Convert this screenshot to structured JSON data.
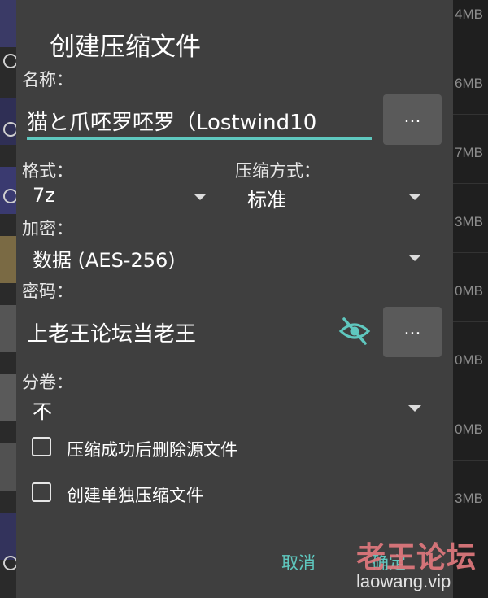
{
  "background": {
    "sizes": [
      "4MB",
      "6MB",
      "7MB",
      "3MB",
      "0MB",
      "0MB",
      "0MB",
      "3MB"
    ]
  },
  "dialog": {
    "title": "创建压缩文件",
    "name_label": "名称：",
    "name_value": "猫と爪呸罗呸罗（Lostwind10",
    "browse_label": "...",
    "format_label": "格式：",
    "format_value": "7z",
    "method_label": "压缩方式：",
    "method_value": "标准",
    "encryption_label": "加密：",
    "encryption_value": "数据 (AES-256)",
    "password_label": "密码：",
    "password_value": "上老王论坛当老王",
    "password_browse_label": "...",
    "split_label": "分卷：",
    "split_value": "不",
    "delete_source_label": "压缩成功后删除源文件",
    "separate_archive_label": "创建单独压缩文件",
    "cancel_label": "取消",
    "ok_label": "确定"
  },
  "watermark": {
    "brand": "老王论坛",
    "url": "laowang.vip"
  },
  "colors": {
    "accent": "#5fc8bf",
    "dialog_bg": "#3f3f3f",
    "watermark": "#e0787d"
  }
}
